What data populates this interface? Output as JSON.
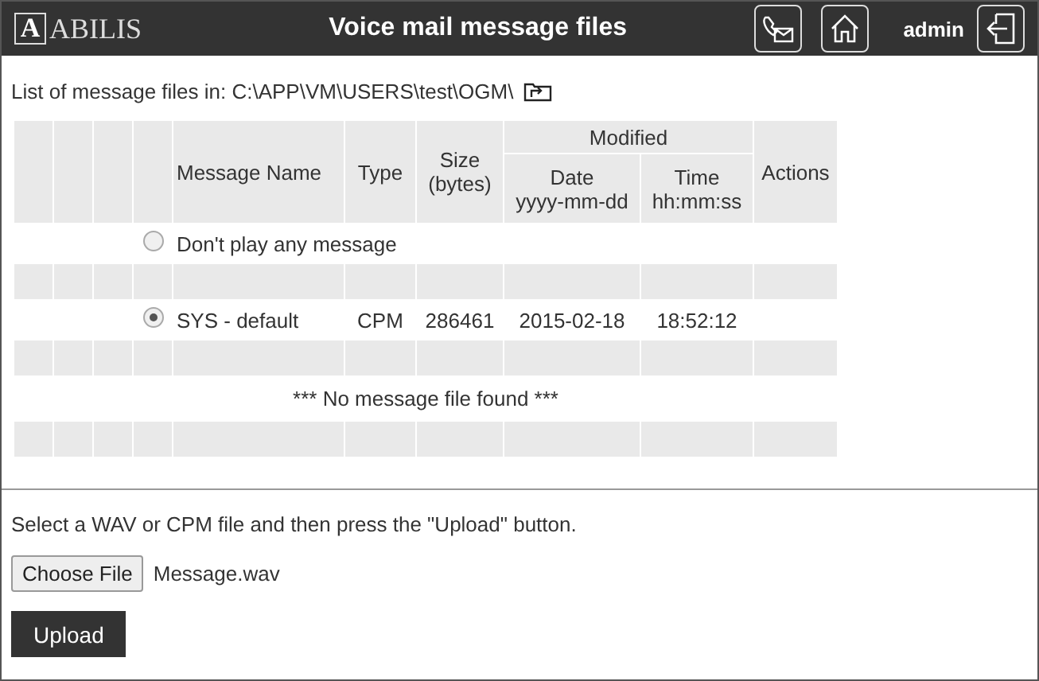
{
  "header": {
    "logo_mark": "A",
    "logo_name": "ABILIS",
    "title": "Voice mail message files",
    "user": "admin"
  },
  "path": {
    "label": "List of message files in: C:\\APP\\VM\\USERS\\test\\OGM\\"
  },
  "table": {
    "columns": [
      {
        "label": [
          "Message Name"
        ]
      },
      {
        "label": [
          "Type"
        ]
      },
      {
        "label": [
          "Size",
          "(bytes)"
        ]
      },
      {
        "kind": "group",
        "label": "Modified",
        "children": [
          {
            "label": [
              "Date",
              "yyyy-mm-dd"
            ]
          },
          {
            "label": [
              "Time",
              "hh:mm:ss"
            ]
          }
        ]
      },
      {
        "label": [
          "Actions"
        ]
      }
    ],
    "rows": [
      {
        "kind": "option",
        "selected": false,
        "name": "Don't play any message"
      },
      {
        "kind": "spacer"
      },
      {
        "kind": "file",
        "selected": true,
        "name": "SYS - default",
        "type": "CPM",
        "size": "286461",
        "date": "2015-02-18",
        "time": "18:52:12"
      },
      {
        "kind": "spacer"
      },
      {
        "kind": "notice",
        "text": "*** No message file found ***"
      },
      {
        "kind": "spacer"
      }
    ]
  },
  "upload": {
    "hint": "Select a WAV or CPM file and then press the \"Upload\" button.",
    "choose": "Choose File",
    "file": "Message.wav",
    "button": "Upload"
  }
}
